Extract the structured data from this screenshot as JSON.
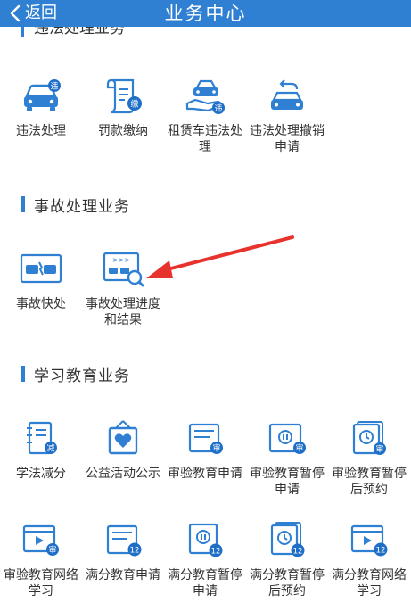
{
  "header": {
    "back_label": "返回",
    "title": "业务中心"
  },
  "colors": {
    "accent": "#2f7fd3",
    "icon_badge": "#1f6fc8",
    "arrow": "#e8322d"
  },
  "partial_section": {
    "title": "违法处理业务"
  },
  "sections": [
    {
      "title": "",
      "items": [
        {
          "label": "违法处理",
          "icon": "car-violation-icon"
        },
        {
          "label": "罚款缴纳",
          "icon": "fine-payment-icon"
        },
        {
          "label": "租赁车违法处理",
          "icon": "rental-car-violation-icon"
        },
        {
          "label": "违法处理撤销申请",
          "icon": "violation-revoke-icon"
        }
      ]
    },
    {
      "title": "事故处理业务",
      "items": [
        {
          "label": "事故快处",
          "icon": "quick-accident-icon"
        },
        {
          "label": "事故处理进度和结果",
          "icon": "accident-progress-icon"
        }
      ]
    },
    {
      "title": "学习教育业务",
      "items": [
        {
          "label": "学法减分",
          "icon": "study-deduct-points-icon"
        },
        {
          "label": "公益活动公示",
          "icon": "charity-activity-icon"
        },
        {
          "label": "审验教育申请",
          "icon": "review-education-apply-icon"
        },
        {
          "label": "审验教育暂停申请",
          "icon": "review-education-pause-icon"
        },
        {
          "label": "审验教育暂停后预约",
          "icon": "review-education-appointment-icon"
        },
        {
          "label": "审验教育网络学习",
          "icon": "review-education-online-icon"
        },
        {
          "label": "满分教育申请",
          "icon": "full-score-education-apply-icon"
        },
        {
          "label": "满分教育暂停申请",
          "icon": "full-score-education-pause-icon"
        },
        {
          "label": "满分教育暂停后预约",
          "icon": "full-score-education-appointment-icon"
        },
        {
          "label": "满分教育网络学习",
          "icon": "full-score-education-online-icon"
        }
      ]
    }
  ],
  "badges": {
    "violation": "违",
    "fine": "缴",
    "reduce": "减",
    "review": "审",
    "score": "12"
  }
}
